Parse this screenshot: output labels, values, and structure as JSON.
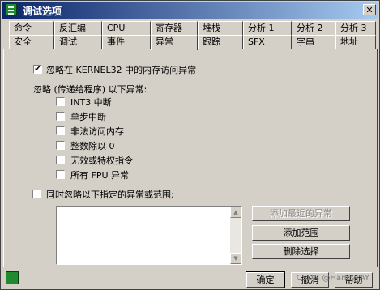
{
  "window": {
    "title": "调试选项",
    "close_label": "✕"
  },
  "tabs_row1": [
    "命令",
    "反汇编",
    "CPU",
    "寄存器",
    "堆栈",
    "分析 1",
    "分析 2",
    "分析 3"
  ],
  "tabs_row2": [
    "安全",
    "调试",
    "事件",
    "异常",
    "跟踪",
    "SFX",
    "字串",
    "地址"
  ],
  "active_tab": "异常",
  "exceptions": {
    "ignore_kernel32": {
      "label": "忽略在 KERNEL32 中的内存访问异常",
      "checked": true
    },
    "pass_heading": "忽略 (传递给程序) 以下异常:",
    "items": [
      {
        "label": "INT3 中断",
        "checked": false
      },
      {
        "label": "单步中断",
        "checked": false
      },
      {
        "label": "非法访问内存",
        "checked": false
      },
      {
        "label": "整数除以 0",
        "checked": false
      },
      {
        "label": "无效或特权指令",
        "checked": false
      },
      {
        "label": "所有 FPU 异常",
        "checked": false
      }
    ],
    "range_option": {
      "label": "同时忽略以下指定的异常或范围:",
      "checked": false
    }
  },
  "range_buttons": {
    "add_last": "添加最近的异常",
    "add_range": "添加范围",
    "delete": "删除选择"
  },
  "footer": {
    "ok": "确定",
    "cancel": "撤消",
    "help": "帮助"
  },
  "watermark": "CSDN @Hancy_AY"
}
